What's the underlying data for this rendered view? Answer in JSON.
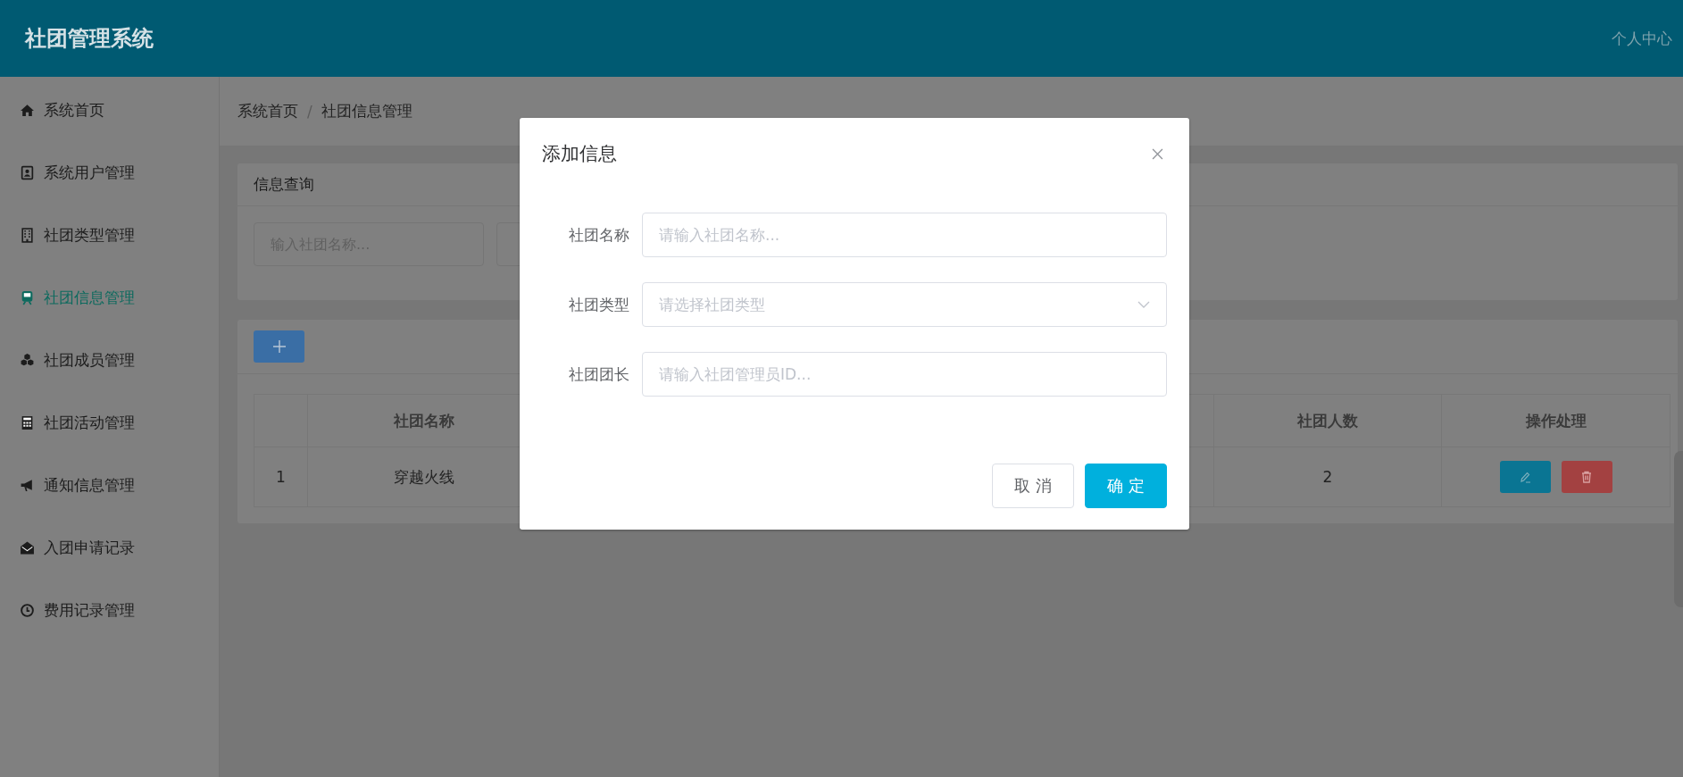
{
  "header": {
    "title": "社团管理系统",
    "user_menu": "个人中心"
  },
  "sidebar": {
    "items": [
      {
        "label": "系统首页",
        "selected": false
      },
      {
        "label": "系统用户管理",
        "selected": false
      },
      {
        "label": "社团类型管理",
        "selected": false
      },
      {
        "label": "社团信息管理",
        "selected": true
      },
      {
        "label": "社团成员管理",
        "selected": false
      },
      {
        "label": "社团活动管理",
        "selected": false
      },
      {
        "label": "通知信息管理",
        "selected": false
      },
      {
        "label": "入团申请记录",
        "selected": false
      },
      {
        "label": "费用记录管理",
        "selected": false
      }
    ]
  },
  "breadcrumb": {
    "items": [
      "系统首页",
      "社团信息管理"
    ],
    "separator": "/"
  },
  "query": {
    "title": "信息查询",
    "placeholder": "输入社团名称..."
  },
  "table": {
    "columns": [
      "社团名称",
      "社团人数",
      "操作处理"
    ],
    "rows": [
      {
        "index": "1",
        "name": "穿越火线",
        "members": "2"
      }
    ]
  },
  "dialog": {
    "title": "添加信息",
    "fields": [
      {
        "label": "社团名称",
        "placeholder": "请输入社团名称...",
        "kind": "input"
      },
      {
        "label": "社团类型",
        "placeholder": "请选择社团类型",
        "kind": "select"
      },
      {
        "label": "社团团长",
        "placeholder": "请输入社团管理员ID...",
        "kind": "input"
      }
    ],
    "buttons": [
      {
        "label": "取 消",
        "kind": "default"
      },
      {
        "label": "确 定",
        "kind": "primary"
      }
    ]
  }
}
